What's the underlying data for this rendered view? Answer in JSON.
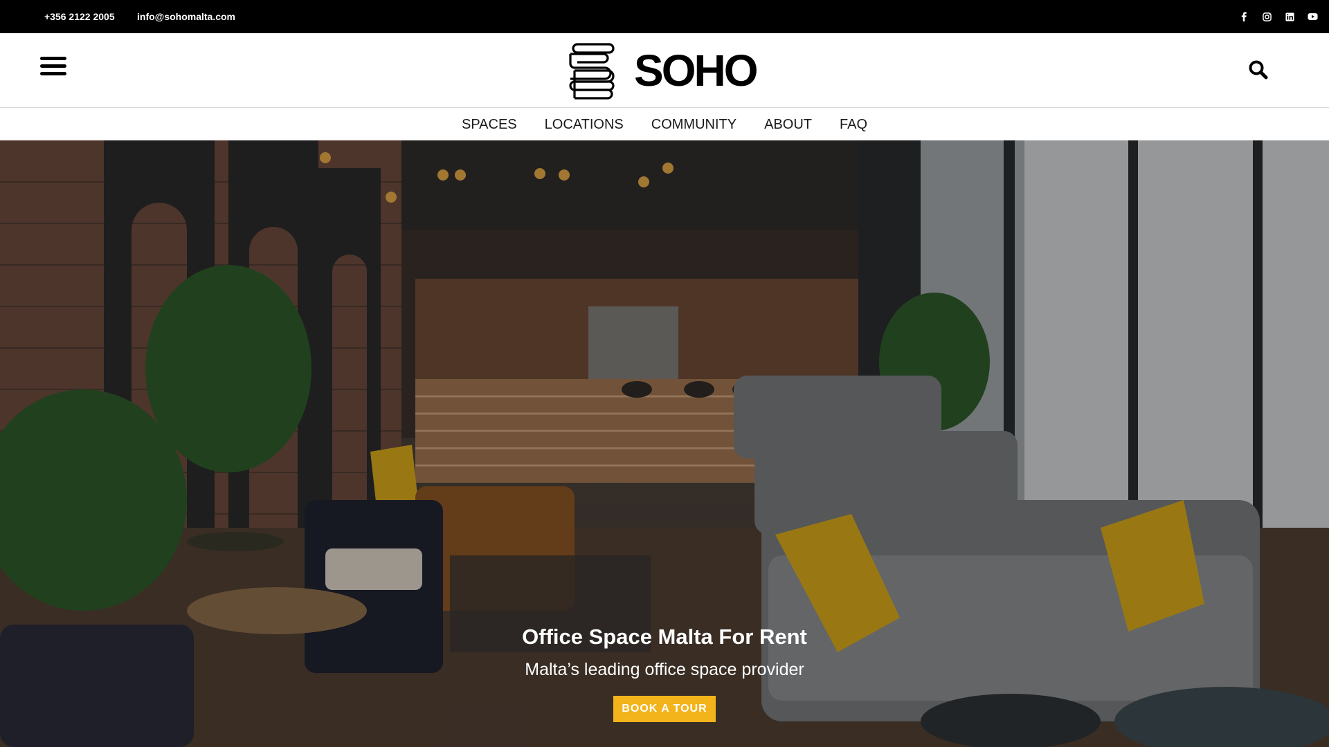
{
  "topbar": {
    "phone": "+356 2122 2005",
    "email": "info@sohomalta.com",
    "social": [
      {
        "icon": "facebook-icon",
        "glyph": "f"
      },
      {
        "icon": "instagram-icon",
        "glyph": ""
      },
      {
        "icon": "linkedin-icon",
        "glyph": ""
      },
      {
        "icon": "youtube-icon",
        "glyph": ""
      }
    ]
  },
  "header": {
    "logo_text": "SOHO",
    "menu_icon": "hamburger-menu-icon",
    "search_icon": "search-icon"
  },
  "nav": {
    "items": [
      "SPACES",
      "LOCATIONS",
      "COMMUNITY",
      "ABOUT",
      "FAQ"
    ]
  },
  "hero": {
    "title": "Office Space Malta For Rent",
    "subtitle": "Malta’s leading office space provider",
    "cta_label": "BOOK A TOUR"
  },
  "colors": {
    "topbar": "#000000",
    "accent": "#f2b31b",
    "text": "#1a1a1a"
  }
}
